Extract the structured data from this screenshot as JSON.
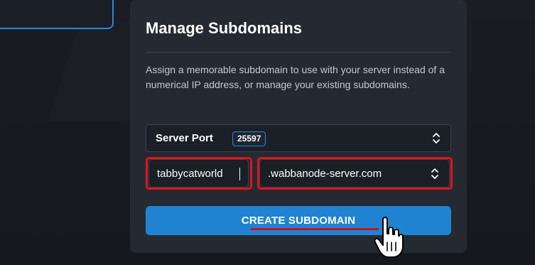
{
  "panel": {
    "title": "Manage Subdomains",
    "description": "Assign a memorable subdomain to use with your server instead of a numerical IP address, or manage your existing subdomains."
  },
  "server_port": {
    "label": "Server Port",
    "value": "25597",
    "icon": "chevron-up-down-icon"
  },
  "subdomain": {
    "value": "tabbycatworld"
  },
  "domain_select": {
    "value": ".wabbanode-server.com",
    "icon": "chevron-up-down-icon"
  },
  "create_button": {
    "label": "CREATE SUBDOMAIN"
  },
  "colors": {
    "accent": "#2083d1",
    "highlight": "#e0141c",
    "panel": "#252931"
  }
}
